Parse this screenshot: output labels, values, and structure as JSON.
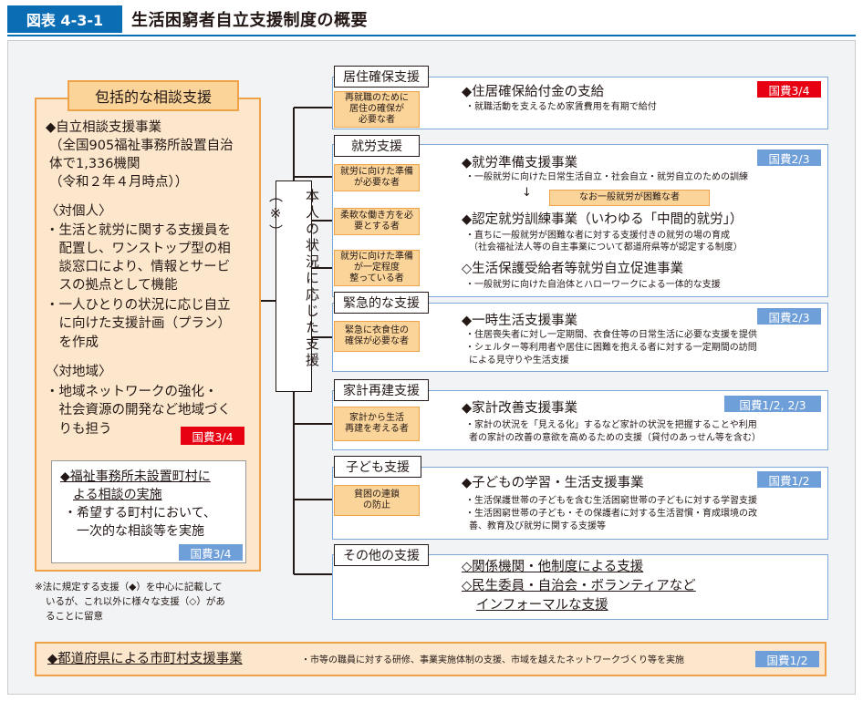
{
  "header": {
    "label": "図表 4-3-1",
    "title": "生活困窮者自立支援制度の概要"
  },
  "left": {
    "tag": "包括的な相談支援",
    "program_title": "◆自立相談支援事業",
    "detail_lines": [
      "（全国905福祉事務所設置自治",
      "体で1,336機関",
      "（令和２年４月時点））"
    ],
    "individual_heading": "〈対個人〉",
    "individual_lines": [
      "・生活と就労に関する支援員を",
      "　配置し、ワンストップ型の相",
      "　談窓口により、情報とサービ",
      "　スの拠点として機能",
      "・一人ひとりの状況に応じ自立",
      "　に向けた支援計画（プラン）",
      "　を作成"
    ],
    "region_heading": "〈対地域〉",
    "region_lines": [
      "・地域ネットワークの強化・",
      "　社会資源の開発など地域づく",
      "　りも担う"
    ],
    "badge": "国費3/4",
    "inner_title_lines": [
      "◆福祉事務所未設置町村に",
      "よる相談の実施"
    ],
    "inner_lines": [
      "・希望する町村において、",
      "一次的な相談等を実施"
    ],
    "inner_badge": "国費3/4",
    "note_lines": [
      "※法に規定する支援（◆）を中心に記載して",
      "いるが、これ以外に様々な支援（◇）があ",
      "ることに留意"
    ]
  },
  "center": {
    "text": "本人の状況に応じた支援（※）"
  },
  "sections": [
    {
      "tag": "居住確保支援",
      "badge": "国費3/4",
      "cond_lines": [
        "再就職のために",
        "居住の確保が",
        "必要な者"
      ],
      "title": "◆住居確保給付金の支給",
      "desc": [
        "・就職活動を支えるため家賃費用を有期で給付"
      ]
    },
    {
      "tag": "就労支援",
      "badge": "国費2/3",
      "items": [
        {
          "cond_lines": [
            "就労に向けた準備",
            "が必要な者"
          ],
          "title": "◆就労準備支援事業",
          "desc": [
            "・一般就労に向けた日常生活自立・社会自立・就労自立のための訓練"
          ]
        },
        {
          "cond_lines": [
            "柔軟な働き方を必",
            "要とする者"
          ],
          "title": "◆認定就労訓練事業（いわゆる「中間的就労」）",
          "desc": [
            "・直ちに一般就労が困難な者に対する支援付きの就労の場の育成",
            "（社会福祉法人等の自主事業について都道府県等が認定する制度）"
          ]
        },
        {
          "cond_lines": [
            "就労に向けた準備",
            "が一定程度",
            "整っている者"
          ],
          "title": "◇生活保護受給者等就労自立促進事業",
          "desc": [
            "・一般就労に向けた自治体とハローワークによる一体的な支援"
          ]
        }
      ],
      "arrow": "↓",
      "hard_note": "なお一般就労が困難な者"
    },
    {
      "tag": "緊急的な支援",
      "badge": "国費2/3",
      "cond_lines": [
        "緊急に衣食住の",
        "確保が必要な者"
      ],
      "title": "◆一時生活支援事業",
      "desc": [
        "・住居喪失者に対し一定期間、衣食住等の日常生活に必要な支援を提供",
        "・シェルター等利用者や居住に困難を抱える者に対する一定期間の訪問",
        "による見守りや生活支援"
      ]
    },
    {
      "tag": "家計再建支援",
      "badge": "国費1/2, 2/3",
      "cond_lines": [
        "家計から生活",
        "再建を考える者"
      ],
      "title": "◆家計改善支援事業",
      "desc": [
        "・家計の状況を「見える化」するなど家計の状況を把握することや利用",
        "者の家計の改善の意欲を高めるための支援（貸付のあっせん等を含む）"
      ]
    },
    {
      "tag": "子ども支援",
      "badge": "国費1/2",
      "cond_lines": [
        "貧困の連鎖",
        "の防止"
      ],
      "title": "◆子どもの学習・生活支援事業",
      "desc": [
        "・生活保護世帯の子どもを含む生活困窮世帯の子どもに対する学習支援",
        "・生活困窮世帯の子ども・その保護者に対する生活習慣・育成環境の改",
        "善、教育及び就労に関する支援等"
      ]
    },
    {
      "tag": "その他の支援",
      "lines": [
        "◇関係機関・他制度による支援",
        "◇民生委員・自治会・ボランティアなど",
        "インフォーマルな支援"
      ]
    }
  ],
  "bottom": {
    "title": "◆都道府県による市町村支援事業",
    "desc": "・市等の職員に対する研修、事業実施体制の支援、市域を越えたネットワークづくり等を実施",
    "badge": "国費1/2"
  }
}
